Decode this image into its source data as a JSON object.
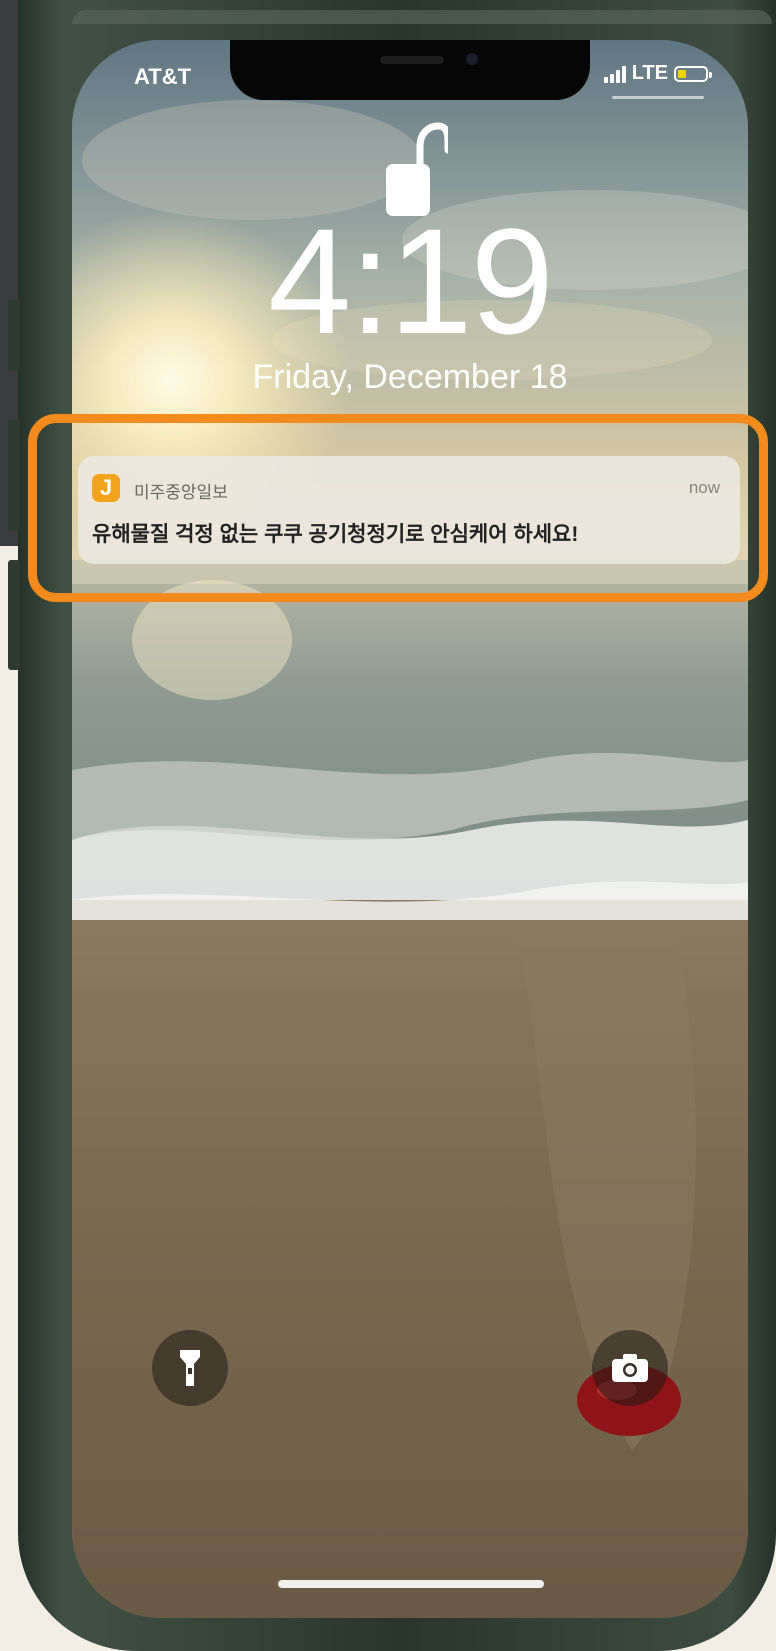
{
  "status_bar": {
    "carrier": "AT&T",
    "network": "LTE",
    "signal_bars": 4,
    "battery_level": 0.3
  },
  "lock_screen": {
    "time": "4:19",
    "date": "Friday, December 18"
  },
  "notification": {
    "app_icon_glyph": "J",
    "app_name": "미주중앙일보",
    "time": "now",
    "message": "유해물질 걱정 없는 쿠쿠 공기청정기로 안심케어 하세요!"
  },
  "colors": {
    "highlight": "#f28a1e",
    "app_icon": "#f2a51c",
    "phone_frame": "#3d4c40"
  },
  "icons": [
    "unlock-icon",
    "flashlight-icon",
    "camera-icon"
  ]
}
